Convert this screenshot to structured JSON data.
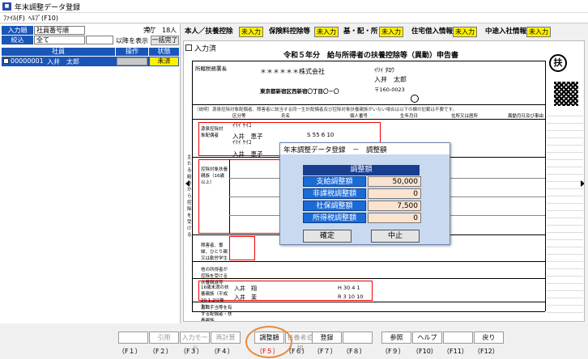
{
  "window": {
    "title": "年末調整データ登録",
    "icon": "app-icon"
  },
  "menu": [
    "ﾌｧｲﾙ(F)",
    "ﾍﾙﾌﾟ(F10)"
  ],
  "left": {
    "sort_label": "入力順",
    "sort_value": "社員番号順",
    "filter_label": "絞込",
    "filter_value": "全て",
    "done_label": "完了",
    "done_count": "0/",
    "total_count": "18人",
    "show_label": "以降を表示",
    "batch_button": "一括完了",
    "col_employee": "社員",
    "col_op": "操作",
    "col_status": "状態",
    "rows": [
      {
        "id": "00000001",
        "name": "入井　太郎",
        "op": "",
        "status": "未済"
      }
    ]
  },
  "tabs": [
    {
      "label": "本人／扶養控除",
      "status": "未入力"
    },
    {
      "label": "保険料控除等",
      "status": "未入力"
    },
    {
      "label": "基・配・所",
      "status": "未入力"
    },
    {
      "label": "住宅借入情報",
      "status": "未入力"
    },
    {
      "label": "中途入社情報",
      "status": "未入力"
    }
  ],
  "form": {
    "done_check_label": "入力済",
    "doc_title": "令和５年分　給与所得者の扶養控除等（異動）申告書",
    "stamp": "扶",
    "company_name": "＊＊＊＊＊＊株式会社",
    "company_address": "東京都新宿区西新宿〇丁目〇－〇",
    "employee_kana": "ｲﾘｲ ﾀﾛｳ",
    "employee_name": "入井　太郎",
    "employee_postal": "〒160-0023",
    "spouse_kana": "ｲﾘｲ ｹｲｺ",
    "spouse_name": "入井　恵子",
    "spouse_dob": "S 55 6 10",
    "section_a": "源泉控除対象配偶者",
    "section_b": "控除対象扶養親族（16歳以上）",
    "section_c": "障害者、寡婦、ひとり親又は勤労学生",
    "section_d": "他の所得者が控除を受ける扶養親族等",
    "section_e": "16歳未満の扶養親族（平成20.1.2以後生）",
    "child1_name": "入井　翔",
    "child1_dob": "H 30 4 1",
    "child2_name": "入井　茉",
    "child2_dob": "R 3 10 10",
    "section_f": "退職手当等を有する配偶者・扶養親族",
    "col_headers": [
      "区分等",
      "氏名",
      "個人番号",
      "生年月日",
      "住所又は居所",
      "異動月日及び事由"
    ]
  },
  "dialog": {
    "title": "年末調整データ登録　－　調整額",
    "header": "調整額",
    "items": [
      {
        "label": "支給調整額",
        "value": "50,000"
      },
      {
        "label": "非課税調整額",
        "value": "0"
      },
      {
        "label": "社保調整額",
        "value": "7,500"
      },
      {
        "label": "所得税調整額",
        "value": "0"
      }
    ],
    "ok": "確定",
    "cancel": "中止"
  },
  "fkeys": [
    {
      "label": "",
      "key": "（F１）",
      "enabled": false
    },
    {
      "label": "引用",
      "key": "（F２）",
      "enabled": false
    },
    {
      "label": "入力モード",
      "key": "（F３）",
      "enabled": false
    },
    {
      "label": "再計算",
      "key": "（F４）",
      "enabled": false
    },
    {
      "label": "調整額",
      "key": "（F５）",
      "enabled": true
    },
    {
      "label": "扶養者追加",
      "key": "（F６）",
      "enabled": false
    },
    {
      "label": "登録",
      "key": "（F７）",
      "enabled": true
    },
    {
      "label": "",
      "key": "（F８）",
      "enabled": false
    },
    {
      "label": "参照",
      "key": "（F９）",
      "enabled": true
    },
    {
      "label": "ヘルプ",
      "key": "（F10）",
      "enabled": true
    },
    {
      "label": "",
      "key": "（F11）",
      "enabled": false
    },
    {
      "label": "戻り",
      "key": "（F12）",
      "enabled": true
    }
  ],
  "colors": {
    "accent": "#1a56b8",
    "badge": "#ffef00",
    "highlight": "#e88a3a",
    "f5key": "#e00000"
  }
}
